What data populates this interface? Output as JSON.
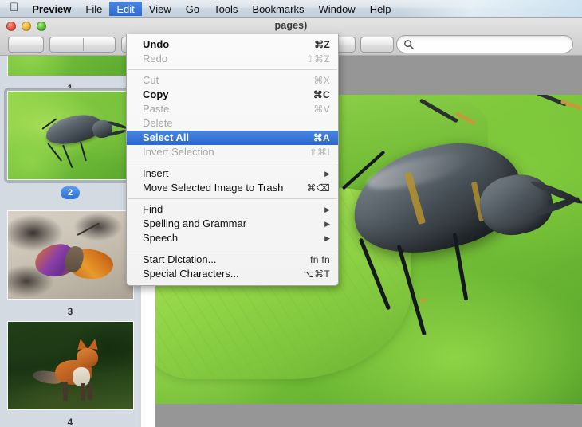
{
  "menubar": {
    "apple_glyph": "⌘",
    "items": [
      {
        "label": "Preview",
        "bold": true,
        "active": false
      },
      {
        "label": "File",
        "bold": false,
        "active": false
      },
      {
        "label": "Edit",
        "bold": false,
        "active": true
      },
      {
        "label": "View",
        "bold": false,
        "active": false
      },
      {
        "label": "Go",
        "bold": false,
        "active": false
      },
      {
        "label": "Tools",
        "bold": false,
        "active": false
      },
      {
        "label": "Bookmarks",
        "bold": false,
        "active": false
      },
      {
        "label": "Window",
        "bold": false,
        "active": false
      },
      {
        "label": "Help",
        "bold": false,
        "active": false
      }
    ]
  },
  "window": {
    "title_visible_fragment": "pages)",
    "traffic_lights": [
      "close",
      "minimize",
      "zoom"
    ]
  },
  "toolbar": {
    "search_placeholder": "",
    "search_value": "",
    "search_icon": "search-icon",
    "buttons": [
      "sidebar-toggle",
      "zoom-group",
      "share",
      "markup",
      "rotate"
    ]
  },
  "sidebar": {
    "thumbnails": [
      {
        "page": "1",
        "selected": false,
        "art": "partial-top",
        "name": "thumbnail-page-1"
      },
      {
        "page": "2",
        "selected": true,
        "art": "beetle",
        "name": "thumbnail-page-2"
      },
      {
        "page": "3",
        "selected": false,
        "art": "butterfly",
        "name": "thumbnail-page-3"
      },
      {
        "page": "4",
        "selected": false,
        "art": "fox",
        "name": "thumbnail-page-4"
      }
    ]
  },
  "content": {
    "photo_subject": "stag beetle on green leaf",
    "background_color": "#969696"
  },
  "edit_menu": {
    "title": "Edit",
    "items": [
      {
        "type": "item",
        "label": "Undo",
        "shortcut": "⌘Z",
        "state": "enabled-bold",
        "submenu": false
      },
      {
        "type": "item",
        "label": "Redo",
        "shortcut": "⇧⌘Z",
        "state": "disabled",
        "submenu": false
      },
      {
        "type": "separator"
      },
      {
        "type": "item",
        "label": "Cut",
        "shortcut": "⌘X",
        "state": "disabled",
        "submenu": false
      },
      {
        "type": "item",
        "label": "Copy",
        "shortcut": "⌘C",
        "state": "enabled-bold",
        "submenu": false
      },
      {
        "type": "item",
        "label": "Paste",
        "shortcut": "⌘V",
        "state": "disabled",
        "submenu": false
      },
      {
        "type": "item",
        "label": "Delete",
        "shortcut": "",
        "state": "disabled",
        "submenu": false
      },
      {
        "type": "item",
        "label": "Select All",
        "shortcut": "⌘A",
        "state": "highlighted",
        "submenu": false
      },
      {
        "type": "item",
        "label": "Invert Selection",
        "shortcut": "⇧⌘I",
        "state": "disabled",
        "submenu": false
      },
      {
        "type": "separator"
      },
      {
        "type": "item",
        "label": "Insert",
        "shortcut": "",
        "state": "enabled",
        "submenu": true
      },
      {
        "type": "item",
        "label": "Move Selected Image to Trash",
        "shortcut": "⌘⌫",
        "state": "enabled",
        "submenu": false
      },
      {
        "type": "separator"
      },
      {
        "type": "item",
        "label": "Find",
        "shortcut": "",
        "state": "enabled",
        "submenu": true
      },
      {
        "type": "item",
        "label": "Spelling and Grammar",
        "shortcut": "",
        "state": "enabled",
        "submenu": true
      },
      {
        "type": "item",
        "label": "Speech",
        "shortcut": "",
        "state": "enabled",
        "submenu": true
      },
      {
        "type": "separator"
      },
      {
        "type": "item",
        "label": "Start Dictation...",
        "shortcut": "fn fn",
        "state": "enabled",
        "submenu": false
      },
      {
        "type": "item",
        "label": "Special Characters...",
        "shortcut": "⌥⌘T",
        "state": "enabled",
        "submenu": false
      }
    ],
    "submenu_arrow_glyph": "▶",
    "highlight_color": "#2f6bd0"
  }
}
